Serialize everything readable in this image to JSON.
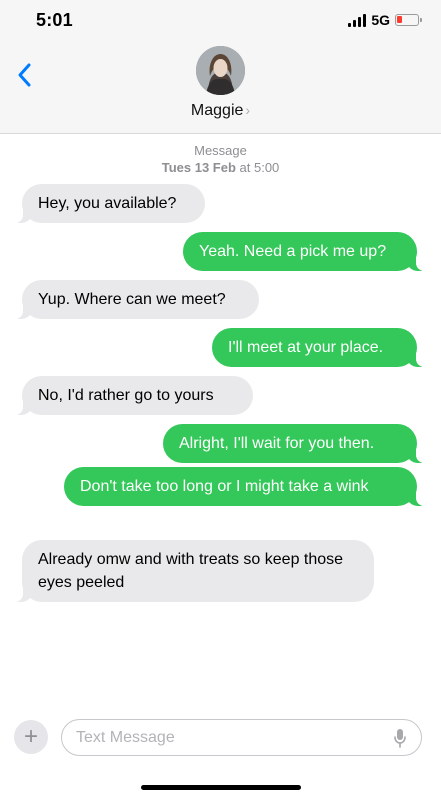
{
  "status_bar": {
    "time": "5:01",
    "network": "5G"
  },
  "header": {
    "contact_name": "Maggie",
    "chevron": "›"
  },
  "thread": {
    "service": "Message",
    "date_bold": "Tues 13 Feb",
    "date_rest": " at 5:00",
    "messages": [
      {
        "dir": "in",
        "text": "Hey, you available?"
      },
      {
        "dir": "out",
        "text": "Yeah. Need a pick me up?"
      },
      {
        "dir": "in",
        "text": "Yup. Where can we meet?"
      },
      {
        "dir": "out",
        "text": "I'll meet at your place."
      },
      {
        "dir": "in",
        "text": "No, I'd rather go to yours"
      },
      {
        "dir": "out",
        "text": "Alright, I'll wait for you then."
      },
      {
        "dir": "out",
        "text": "Don't take too long or I might take a wink"
      },
      {
        "dir": "in",
        "text": "Already omw and with treats so keep those eyes peeled"
      }
    ]
  },
  "composer": {
    "placeholder": "Text Message",
    "plus": "+"
  },
  "icons": {
    "back": "chevron-left-icon",
    "mic": "microphone-icon",
    "add": "plus-icon"
  },
  "colors": {
    "accent": "#007aff",
    "outgoing": "#34c759",
    "incoming": "#e9e9eb",
    "battery_low": "#ff3b30"
  }
}
